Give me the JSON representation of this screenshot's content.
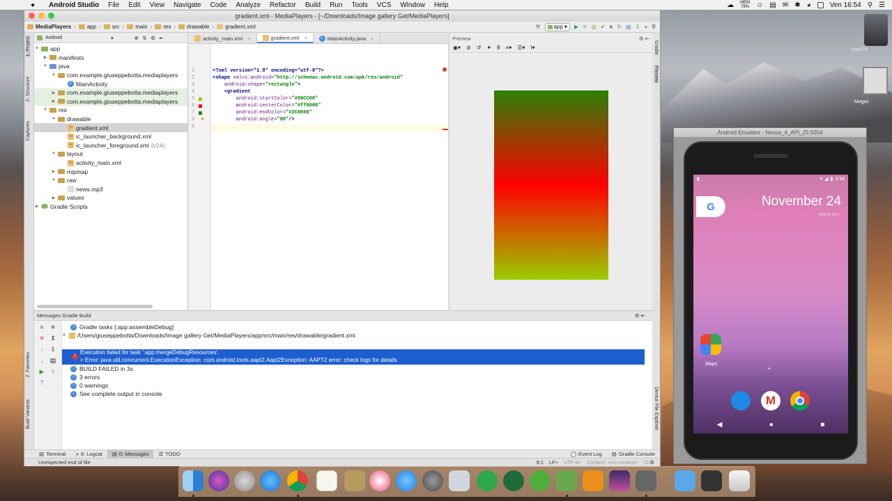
{
  "menubar": {
    "app_name": "Android Studio",
    "items": [
      "File",
      "Edit",
      "View",
      "Navigate",
      "Code",
      "Analyze",
      "Refactor",
      "Build",
      "Run",
      "Tools",
      "VCS",
      "Window",
      "Help"
    ],
    "mem_label": "MEM",
    "mem_value": "78%",
    "clock": "Ven 16:54"
  },
  "window": {
    "title": "gradient.xml - MediaPlayers - [~/Downloads/Image gallery Get/MediaPlayers]"
  },
  "breadcrumbs": [
    "MediaPlayers",
    "app",
    "src",
    "main",
    "res",
    "drawable",
    "gradient.xml"
  ],
  "toolbar": {
    "run_config": "app"
  },
  "project": {
    "view_label": "Android",
    "tree": [
      {
        "label": "app",
        "depth": 0
      },
      {
        "label": "manifests",
        "depth": 1
      },
      {
        "label": "java",
        "depth": 1
      },
      {
        "label": "com.example.giuseppebotta.mediaplayers",
        "depth": 2
      },
      {
        "label": "MainActivity",
        "depth": 3
      },
      {
        "label": "com.example.giuseppebotta.mediaplayers",
        "depth": 2
      },
      {
        "label": "com.example.giuseppebotta.mediaplayers",
        "depth": 2
      },
      {
        "label": "res",
        "depth": 1
      },
      {
        "label": "drawable",
        "depth": 2
      },
      {
        "label": "gradient.xml",
        "depth": 3
      },
      {
        "label": "ic_launcher_background.xml",
        "depth": 3
      },
      {
        "label": "ic_launcher_foreground.xml",
        "depth": 3,
        "suffix": "(v24)"
      },
      {
        "label": "layout",
        "depth": 2
      },
      {
        "label": "activity_main.xml",
        "depth": 3
      },
      {
        "label": "mipmap",
        "depth": 2
      },
      {
        "label": "raw",
        "depth": 2
      },
      {
        "label": "news.mp3",
        "depth": 3
      },
      {
        "label": "values",
        "depth": 2
      },
      {
        "label": "Gradle Scripts",
        "depth": 0
      }
    ]
  },
  "side_tabs": {
    "left_top": [
      "1: Project",
      "2: Structure",
      "Captures"
    ],
    "left_bottom": [
      "2: Favorites",
      "Build Variants"
    ],
    "right_top": [
      "Gradle",
      "Preview"
    ],
    "right_bottom": [
      "Device File Explorer"
    ]
  },
  "editor": {
    "tabs": [
      "activity_main.xml",
      "gradient.xml",
      "MainActivity.java"
    ],
    "line_numbers": [
      "1",
      "2",
      "3",
      "4",
      "5",
      "6",
      "7",
      "8",
      "9"
    ],
    "lines": [
      {
        "tag": "<?xml version=\"1.0\" encoding=\"utf-8\"?>"
      },
      {
        "a": "<shape ",
        "b": "xmlns:android=",
        "c": "\"http://schemas.android.com/apk/res/android\""
      },
      {
        "a": "    ",
        "b": "android:shape=",
        "c": "\"rectangle\"",
        "d": ">"
      },
      {
        "a": "    <gradient"
      },
      {
        "a": "        ",
        "b": "android:startColor=",
        "c": "\"#99CC00\""
      },
      {
        "a": "        ",
        "b": "android:centerColor=",
        "c": "\"#ff0000\""
      },
      {
        "a": "        ",
        "b": "android:endColor=",
        "c": "\"#2C0008\""
      },
      {
        "a": "        ",
        "b": "android:angle=",
        "c": "\"90\"",
        "d": "/>"
      },
      {
        "a": ""
      }
    ]
  },
  "preview": {
    "title": "Preview",
    "zoom_value": "8",
    "gradient": {
      "start": "#99CC00",
      "center": "#ff0000",
      "end": "#2C8008",
      "angle": "90"
    }
  },
  "messages": {
    "title": "Messages Gradle Build",
    "items": [
      "Gradle tasks [:app:assembleDebug]",
      "/Users/giuseppebotta/Downloads/Image gallery Get/MediaPlayers/app/src/main/res/drawable/gradient.xml",
      "Execution failed for task ':app:mergeDebugResources'.",
      "> Error: java.util.concurrent.ExecutionException: com.android.tools.aapt2.Aapt2Exception: AAPT2 error: check logs for details",
      "BUILD FAILED in 3s",
      "3 errors",
      "0 warnings",
      "See complete output in console"
    ]
  },
  "bottom_tabs": [
    "Terminal",
    "6: Logcat",
    "0: Messages",
    "TODO"
  ],
  "bottom_right_tabs": [
    "Event Log",
    "Gradle Console"
  ],
  "status": {
    "message": "Unexpected end of file",
    "position": "9:1",
    "line_sep": "LF÷",
    "encoding": "UTF-8÷",
    "context": "Context: <no context>"
  },
  "emulator": {
    "title": "Android Emulator - Nexus_4_API_25:5554",
    "time": "3:54",
    "date": "November 24",
    "day": "FRIDAY 2017",
    "maps_label": "Maps"
  },
  "desktop": {
    "label1": "macOS",
    "label2": "Magaz"
  }
}
